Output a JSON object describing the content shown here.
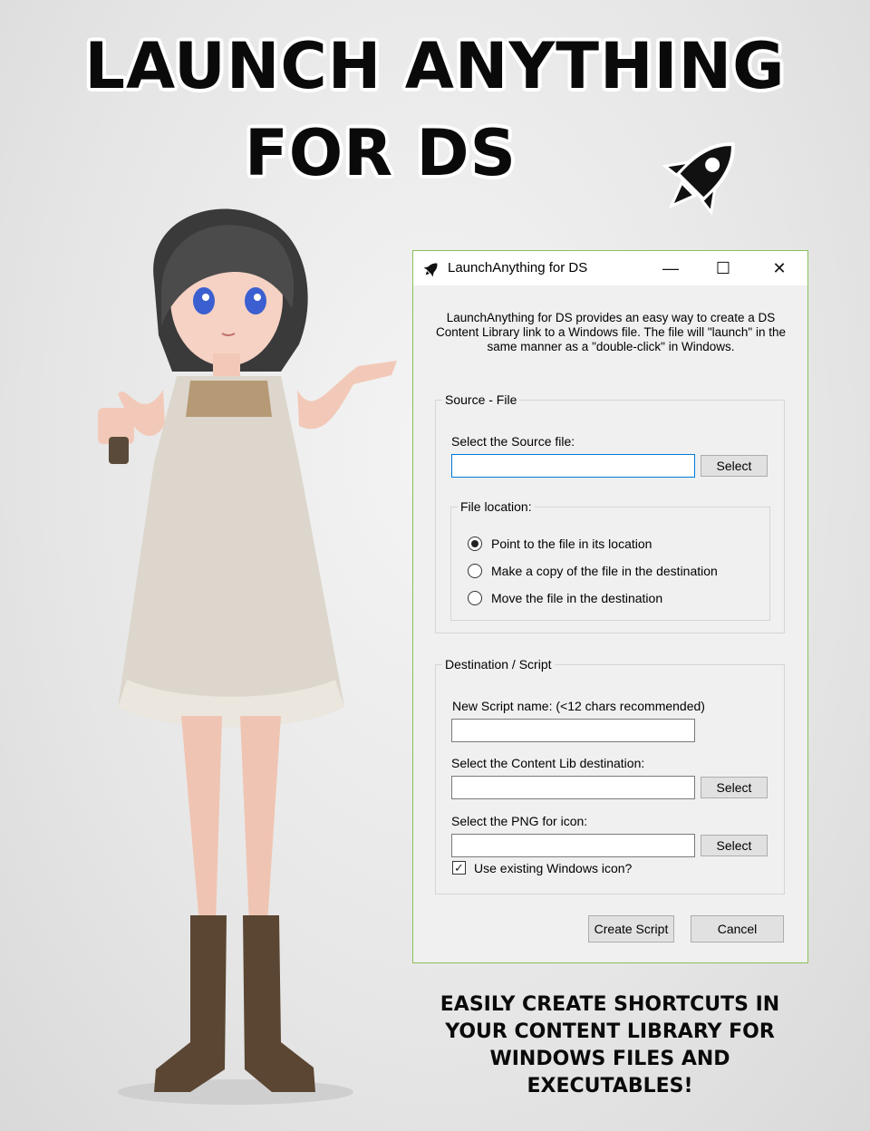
{
  "headline": {
    "line1": "LAUNCH ANYTHING",
    "line2": "FOR DS",
    "icon": "rocket-icon"
  },
  "window": {
    "title": "LaunchAnything for DS",
    "controls": {
      "minimize": "—",
      "maximize": "☐",
      "close": "✕"
    },
    "description": "LaunchAnything for DS provides an easy way to create a DS Content Library link to a Windows file.  The file will \"launch\" in the same manner as a \"double-click\" in Windows.",
    "source_group": {
      "legend": "Source - File",
      "select_label": "Select the Source file:",
      "source_value": "",
      "select_button": "Select",
      "location_group": {
        "legend": "File location:",
        "options": [
          {
            "label": "Point to the file in its location",
            "checked": true
          },
          {
            "label": "Make a copy of the file in the destination",
            "checked": false
          },
          {
            "label": "Move the file in the destination",
            "checked": false
          }
        ]
      }
    },
    "dest_group": {
      "legend": "Destination / Script",
      "script_name_label": "New Script name:  (<12 chars recommended)",
      "script_name_value": "",
      "content_lib_label": "Select the Content Lib destination:",
      "content_lib_value": "",
      "content_lib_button": "Select",
      "png_label": "Select the PNG for icon:",
      "png_value": "",
      "png_button": "Select",
      "checkbox_label": "Use existing Windows icon?",
      "checkbox_checked": true,
      "checkbox_mark": "✓"
    },
    "create_button": "Create Script",
    "cancel_button": "Cancel"
  },
  "tagline": {
    "line1": "EASILY CREATE SHORTCUTS IN",
    "line2": "YOUR CONTENT LIBRARY FOR",
    "line3": "WINDOWS FILES AND",
    "line4": "EXECUTABLES!"
  }
}
